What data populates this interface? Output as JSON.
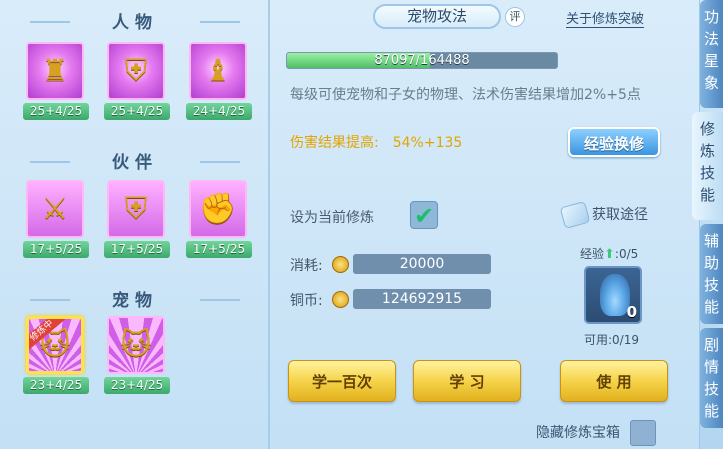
{
  "left": {
    "sections": [
      {
        "title": "人物",
        "items": [
          {
            "icon": "golden-armor-figure-icon",
            "level": "25+4/25",
            "selected": false
          },
          {
            "icon": "golden-shield-armor-icon",
            "level": "25+4/25",
            "selected": false
          },
          {
            "icon": "golden-warrior-statue-icon",
            "level": "24+4/25",
            "selected": false
          }
        ]
      },
      {
        "title": "伙伴",
        "items": [
          {
            "icon": "tiger-sword-icon",
            "level": "17+5/25",
            "selected": false
          },
          {
            "icon": "tiger-shield-icon",
            "level": "17+5/25",
            "selected": false
          },
          {
            "icon": "tiger-fist-icon",
            "level": "17+5/25",
            "selected": false
          }
        ]
      },
      {
        "title": "宠物",
        "items": [
          {
            "icon": "golden-cat-icon",
            "level": "23+4/25",
            "selected": true,
            "ribbon": "修炼中"
          },
          {
            "icon": "golden-cat-shield-icon",
            "level": "23+4/25",
            "selected": false
          }
        ]
      }
    ]
  },
  "header": {
    "title": "宠物攻法",
    "rate_badge": "评",
    "about_link": "关于修炼突破"
  },
  "progress": {
    "text": "87097/164488",
    "fraction": 0.5295
  },
  "description": "每级可使宠物和子女的物理、法术伤害结果增加2%+5点",
  "effect": {
    "label": "伤害结果提高:",
    "value": "54%+135"
  },
  "exp_swap_button": "经验换修",
  "set_current": {
    "label": "设为当前修炼",
    "checked": true
  },
  "acquire_link": "获取途径",
  "cost": {
    "label": "消耗:",
    "value": "20000"
  },
  "copper": {
    "label": "铜币:",
    "value": "124692915"
  },
  "exp_item": {
    "label": "经验",
    "count": ":0/5",
    "icon": "blue-vase-icon",
    "quantity": "0",
    "usable": "可用:0/19"
  },
  "buttons": {
    "learn_hundred": "学一百次",
    "learn": "学 习",
    "use": "使 用"
  },
  "hide_box": "隐藏修炼宝箱",
  "tabs": [
    {
      "label": "功法星象",
      "active": false
    },
    {
      "label": "修炼技能",
      "active": true
    },
    {
      "label": "辅助技能",
      "active": false
    },
    {
      "label": "剧情技能",
      "active": false
    }
  ],
  "colors": {
    "accent_gold": "#f6d34a",
    "accent_blue": "#3a94df",
    "level_green": "#3ca86c",
    "effect_yellow": "#e2a400"
  }
}
